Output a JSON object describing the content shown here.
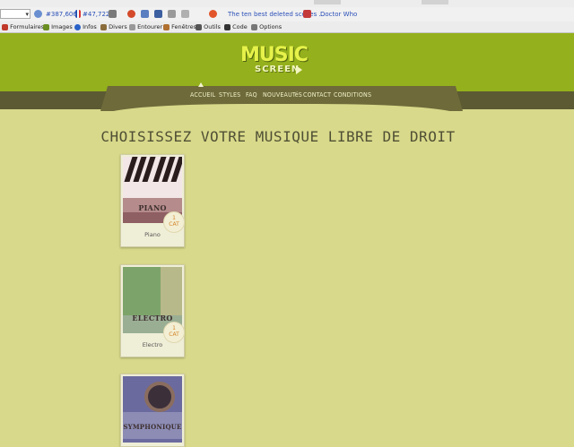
{
  "browser": {
    "toolbar1": {
      "stat1": "#387,606",
      "stat2": "#47,722",
      "tab_title": "The ten best deleted scenes ...",
      "doctor_who": "Doctor Who"
    },
    "toolbar2": {
      "items": [
        "Formulaires",
        "Images",
        "Infos",
        "Divers",
        "Entourer",
        "Fenêtres",
        "Outils",
        "Code",
        "Options"
      ]
    }
  },
  "site": {
    "logo_main": "MUSIC",
    "logo_sub": "SCREEN"
  },
  "nav": {
    "items": [
      "ACCUEIL",
      "STYLES",
      "FAQ",
      "NOUVEAUTéS",
      "CONTACT",
      "CONDITIONS"
    ]
  },
  "main": {
    "title": "CHOISISSEZ VOTRE MUSIQUE LIBRE DE DROIT",
    "cards": [
      {
        "image_word": "PIANO",
        "badge_number": "1",
        "badge_text": "CAT",
        "label": "Piano"
      },
      {
        "image_word": "ELECTRO",
        "badge_number": "1",
        "badge_text": "CAT",
        "label": "Electro"
      },
      {
        "image_word": "SYMPHONIQUE",
        "label": ""
      }
    ]
  },
  "colors": {
    "header_green": "#94b01c",
    "nav_brown": "#6e6a3a",
    "content_bg": "#d8d98a",
    "logo_yellow": "#e6f24a",
    "badge_orange": "#d3852b"
  }
}
